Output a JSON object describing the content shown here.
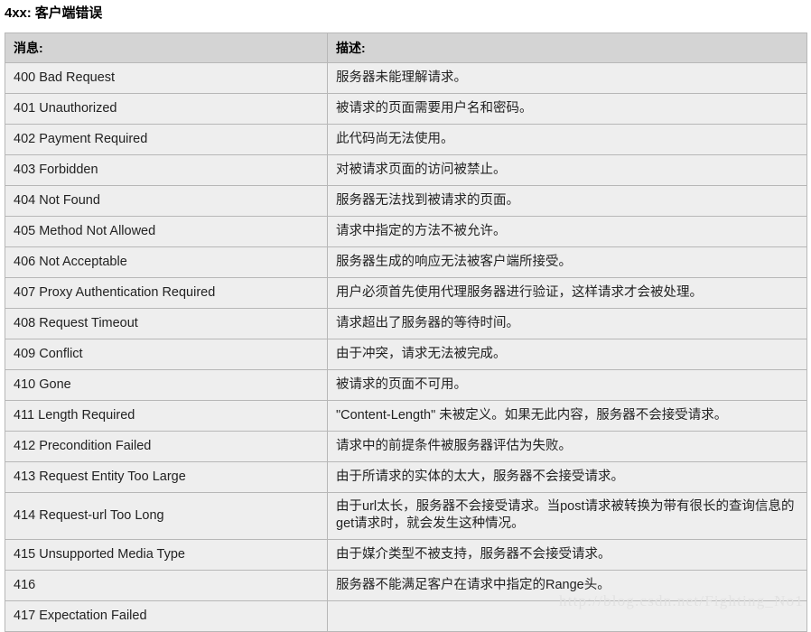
{
  "page": {
    "title": "4xx: 客户端错误"
  },
  "table": {
    "headers": {
      "message": "消息:",
      "description": "描述:"
    },
    "rows": [
      {
        "message": "400 Bad Request",
        "description": "服务器未能理解请求。"
      },
      {
        "message": "401 Unauthorized",
        "description": "被请求的页面需要用户名和密码。"
      },
      {
        "message": "402 Payment Required",
        "description": "此代码尚无法使用。"
      },
      {
        "message": "403 Forbidden",
        "description": "对被请求页面的访问被禁止。"
      },
      {
        "message": "404 Not Found",
        "description": "服务器无法找到被请求的页面。"
      },
      {
        "message": "405 Method Not Allowed",
        "description": "请求中指定的方法不被允许。"
      },
      {
        "message": "406 Not Acceptable",
        "description": "服务器生成的响应无法被客户端所接受。"
      },
      {
        "message": "407 Proxy Authentication Required",
        "description": "用户必须首先使用代理服务器进行验证，这样请求才会被处理。"
      },
      {
        "message": "408 Request Timeout",
        "description": "请求超出了服务器的等待时间。"
      },
      {
        "message": "409 Conflict",
        "description": "由于冲突，请求无法被完成。"
      },
      {
        "message": "410 Gone",
        "description": "被请求的页面不可用。"
      },
      {
        "message": "411 Length Required",
        "description": "\"Content-Length\" 未被定义。如果无此内容，服务器不会接受请求。"
      },
      {
        "message": "412 Precondition Failed",
        "description": "请求中的前提条件被服务器评估为失败。"
      },
      {
        "message": "413 Request Entity Too Large",
        "description": "由于所请求的实体的太大，服务器不会接受请求。"
      },
      {
        "message": "414 Request-url Too Long",
        "description": "由于url太长，服务器不会接受请求。当post请求被转换为带有很长的查询信息的get请求时，就会发生这种情况。"
      },
      {
        "message": "415 Unsupported Media Type",
        "description": "由于媒介类型不被支持，服务器不会接受请求。"
      },
      {
        "message": "416",
        "description": "服务器不能满足客户在请求中指定的Range头。"
      },
      {
        "message": "417 Expectation Failed",
        "description": ""
      }
    ]
  },
  "watermark": {
    "text": "http://blog.csdn.net/Fighting_No1"
  },
  "colors": {
    "header_background": "#d4d4d4",
    "row_background": "#eeeeee",
    "border": "#b7b7b7",
    "text": "#222222",
    "watermark": "#e2e2e2"
  }
}
